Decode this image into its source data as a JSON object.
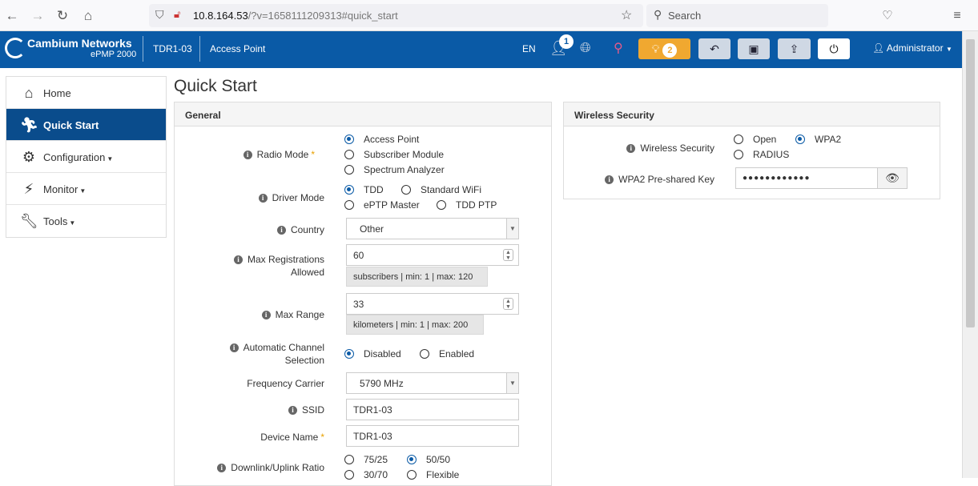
{
  "browser": {
    "url_host": "10.8.164.53",
    "url_rest": "/?v=1658111209313#quick_start",
    "search_placeholder": "Search"
  },
  "header": {
    "brand": "Cambium Networks",
    "product": "ePMP 2000",
    "device_name": "TDR1-03",
    "mode": "Access Point",
    "language": "EN",
    "users_badge": "1",
    "alerts_count": "2",
    "user": "Administrator"
  },
  "sidebar": {
    "items": [
      {
        "label": "Home",
        "icon": "home-icon"
      },
      {
        "label": "Quick Start",
        "icon": "running-man-icon"
      },
      {
        "label": "Configuration",
        "icon": "gear-icon"
      },
      {
        "label": "Monitor",
        "icon": "pulse-icon"
      },
      {
        "label": "Tools",
        "icon": "wrench-icon"
      }
    ]
  },
  "page": {
    "title": "Quick Start"
  },
  "general": {
    "title": "General",
    "radio_mode": {
      "label": "Radio Mode",
      "options": [
        "Access Point",
        "Subscriber Module",
        "Spectrum Analyzer"
      ],
      "selected": "Access Point"
    },
    "driver_mode": {
      "label": "Driver Mode",
      "options": [
        "TDD",
        "Standard WiFi",
        "ePTP Master",
        "TDD PTP"
      ],
      "selected": "TDD"
    },
    "country": {
      "label": "Country",
      "value": "Other"
    },
    "max_registrations": {
      "label_line1": "Max Registrations",
      "label_line2": "Allowed",
      "value": "60",
      "hint": "subscribers | min: 1 | max: 120"
    },
    "max_range": {
      "label": "Max Range",
      "value": "33",
      "hint": "kilometers | min: 1 | max: 200"
    },
    "auto_channel": {
      "label_line1": "Automatic Channel",
      "label_line2": "Selection",
      "options": [
        "Disabled",
        "Enabled"
      ],
      "selected": "Disabled"
    },
    "frequency_carrier": {
      "label": "Frequency Carrier",
      "value": "5790 MHz"
    },
    "ssid": {
      "label": "SSID",
      "value": "TDR1-03"
    },
    "device_name": {
      "label": "Device Name",
      "value": "TDR1-03"
    },
    "dl_ul_ratio": {
      "label": "Downlink/Uplink Ratio",
      "options": [
        "75/25",
        "50/50",
        "30/70",
        "Flexible"
      ],
      "selected": "50/50"
    }
  },
  "wireless_security": {
    "title": "Wireless Security",
    "security": {
      "label": "Wireless Security",
      "options": [
        "Open",
        "WPA2",
        "RADIUS"
      ],
      "selected": "WPA2"
    },
    "psk": {
      "label": "WPA2 Pre-shared Key",
      "value": "●●●●●●●●●●●●"
    }
  }
}
